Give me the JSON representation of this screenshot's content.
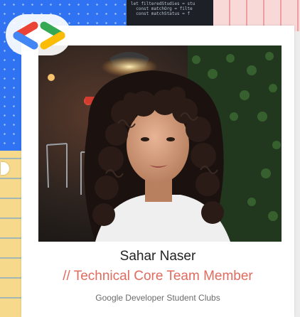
{
  "background": {
    "code_lines": [
      "let filteredStudies = stu",
      "  const matchOrg = filte",
      "  const matchStatus = f"
    ]
  },
  "card": {
    "photo_alt": "Sahar Naser",
    "name": "Sahar Naser",
    "role": "// Technical Core Team Member",
    "organization": "Google Developer Student Clubs"
  },
  "colors": {
    "logo_blue": "#4285F4",
    "logo_red": "#EA4335",
    "logo_green": "#34A853",
    "logo_yellow": "#FBBC05",
    "role_text": "#e06b5e",
    "background_blue": "#2f73f2"
  },
  "icons": {
    "logo": "gdsc-logo-icon"
  }
}
